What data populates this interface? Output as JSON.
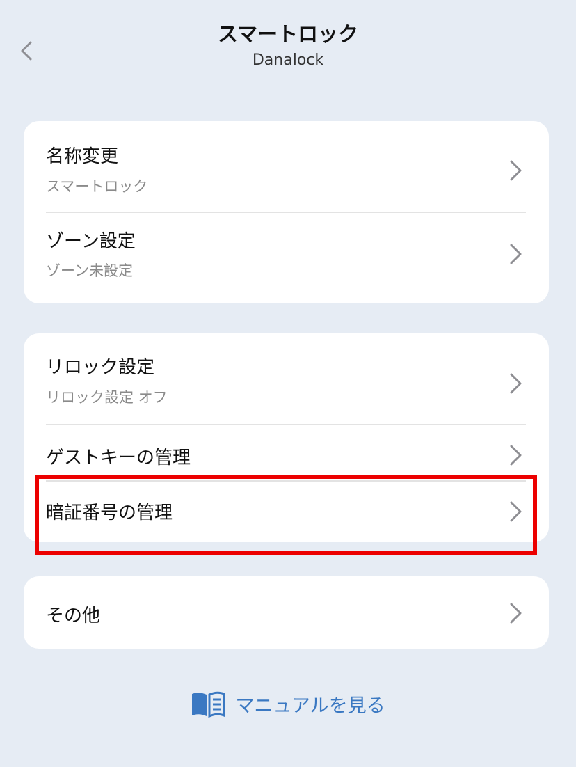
{
  "header": {
    "title": "スマートロック",
    "subtitle": "Danalock",
    "back_icon": "chevron-left-icon"
  },
  "groups": [
    {
      "items": [
        {
          "title": "名称変更",
          "subtitle": "スマートロック"
        },
        {
          "title": "ゾーン設定",
          "subtitle": "ゾーン未設定"
        }
      ]
    },
    {
      "items": [
        {
          "title": "リロック設定",
          "subtitle": "リロック設定 オフ"
        },
        {
          "title": "ゲストキーの管理"
        },
        {
          "title": "暗証番号の管理",
          "highlighted": true
        }
      ]
    },
    {
      "items": [
        {
          "title": "その他"
        }
      ]
    }
  ],
  "footer": {
    "manual_label": "マニュアルを見る",
    "manual_icon": "book-icon"
  },
  "colors": {
    "background": "#e6ecf4",
    "card": "#ffffff",
    "link": "#3a78c2",
    "highlight": "#ec0000",
    "chevron": "#8e8e93"
  }
}
